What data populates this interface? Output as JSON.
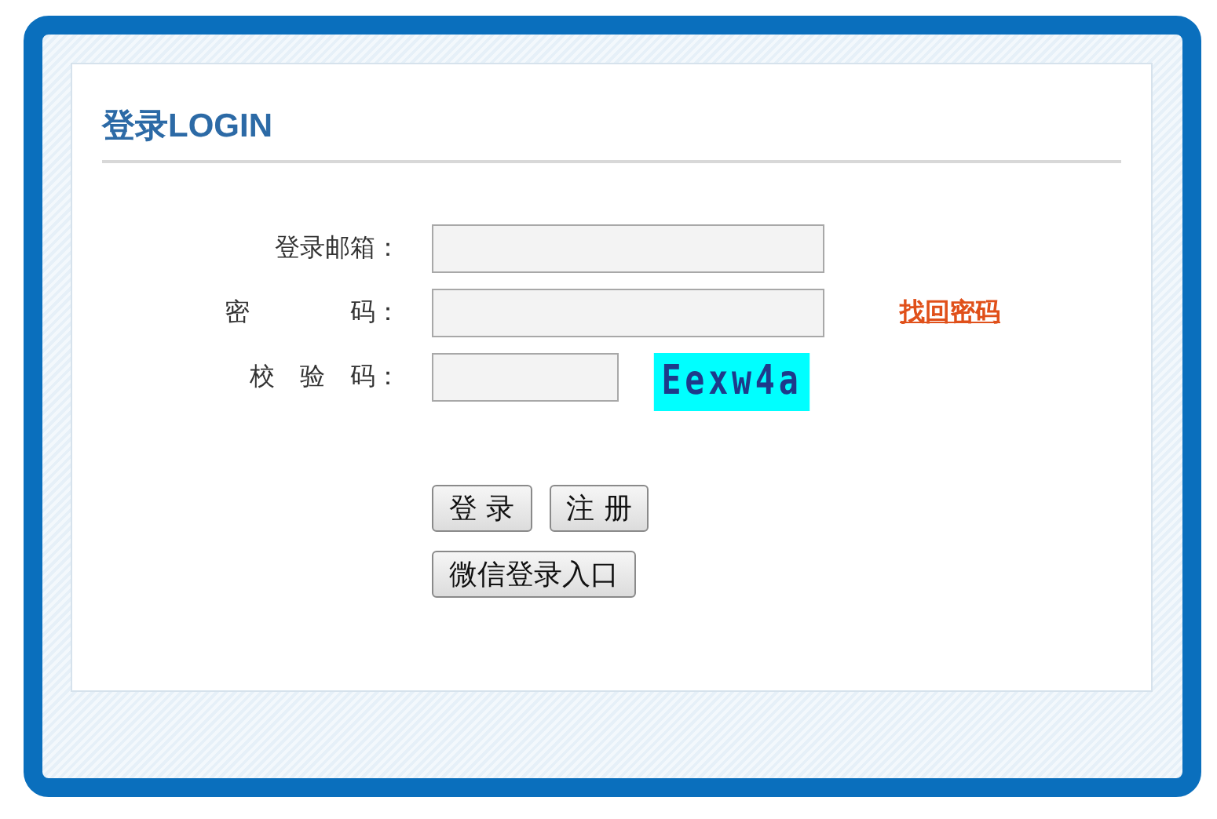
{
  "title": "登录LOGIN",
  "fields": [
    {
      "label": "登录邮箱：",
      "kind": "email"
    },
    {
      "label": "密　　　　码：",
      "kind": "password",
      "link": "找回密码"
    },
    {
      "label": "校　验　码：",
      "kind": "captcha",
      "captcha": "Eexw4a"
    }
  ],
  "buttons": [
    [
      "登 录",
      "注 册"
    ],
    [
      "微信登录入口"
    ]
  ]
}
